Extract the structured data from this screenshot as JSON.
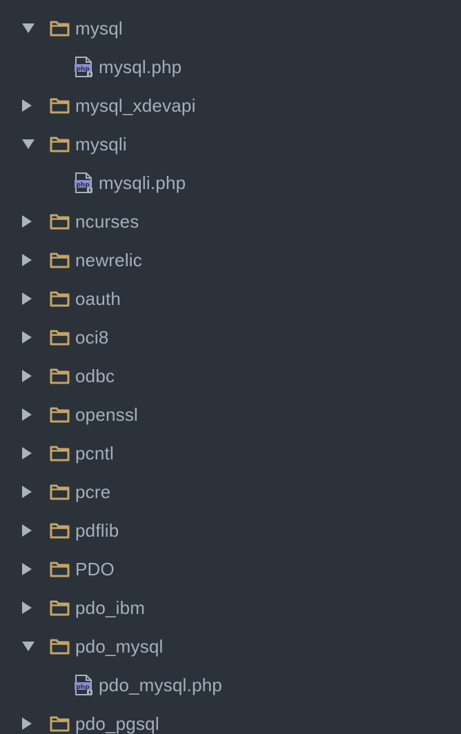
{
  "colors": {
    "background": "#2b323a",
    "text": "#a3b0bd",
    "folder": "#c7a565",
    "arrow": "#a9b4bf",
    "php_badge": "#8a8fd4"
  },
  "tree": {
    "items": [
      {
        "type": "folder",
        "label": "mysql",
        "expanded": true,
        "icon": "folder-icon"
      },
      {
        "type": "file",
        "label": "mysql.php",
        "icon": "php-file-icon"
      },
      {
        "type": "folder",
        "label": "mysql_xdevapi",
        "expanded": false,
        "icon": "folder-icon"
      },
      {
        "type": "folder",
        "label": "mysqli",
        "expanded": true,
        "icon": "folder-icon"
      },
      {
        "type": "file",
        "label": "mysqli.php",
        "icon": "php-file-icon"
      },
      {
        "type": "folder",
        "label": "ncurses",
        "expanded": false,
        "icon": "folder-icon"
      },
      {
        "type": "folder",
        "label": "newrelic",
        "expanded": false,
        "icon": "folder-icon"
      },
      {
        "type": "folder",
        "label": "oauth",
        "expanded": false,
        "icon": "folder-icon"
      },
      {
        "type": "folder",
        "label": "oci8",
        "expanded": false,
        "icon": "folder-icon"
      },
      {
        "type": "folder",
        "label": "odbc",
        "expanded": false,
        "icon": "folder-icon"
      },
      {
        "type": "folder",
        "label": "openssl",
        "expanded": false,
        "icon": "folder-icon"
      },
      {
        "type": "folder",
        "label": "pcntl",
        "expanded": false,
        "icon": "folder-icon"
      },
      {
        "type": "folder",
        "label": "pcre",
        "expanded": false,
        "icon": "folder-icon"
      },
      {
        "type": "folder",
        "label": "pdflib",
        "expanded": false,
        "icon": "folder-icon"
      },
      {
        "type": "folder",
        "label": "PDO",
        "expanded": false,
        "icon": "folder-icon"
      },
      {
        "type": "folder",
        "label": "pdo_ibm",
        "expanded": false,
        "icon": "folder-icon"
      },
      {
        "type": "folder",
        "label": "pdo_mysql",
        "expanded": true,
        "icon": "folder-icon"
      },
      {
        "type": "file",
        "label": "pdo_mysql.php",
        "icon": "php-file-icon"
      },
      {
        "type": "folder",
        "label": "pdo_pgsql",
        "expanded": false,
        "icon": "folder-icon"
      }
    ]
  }
}
